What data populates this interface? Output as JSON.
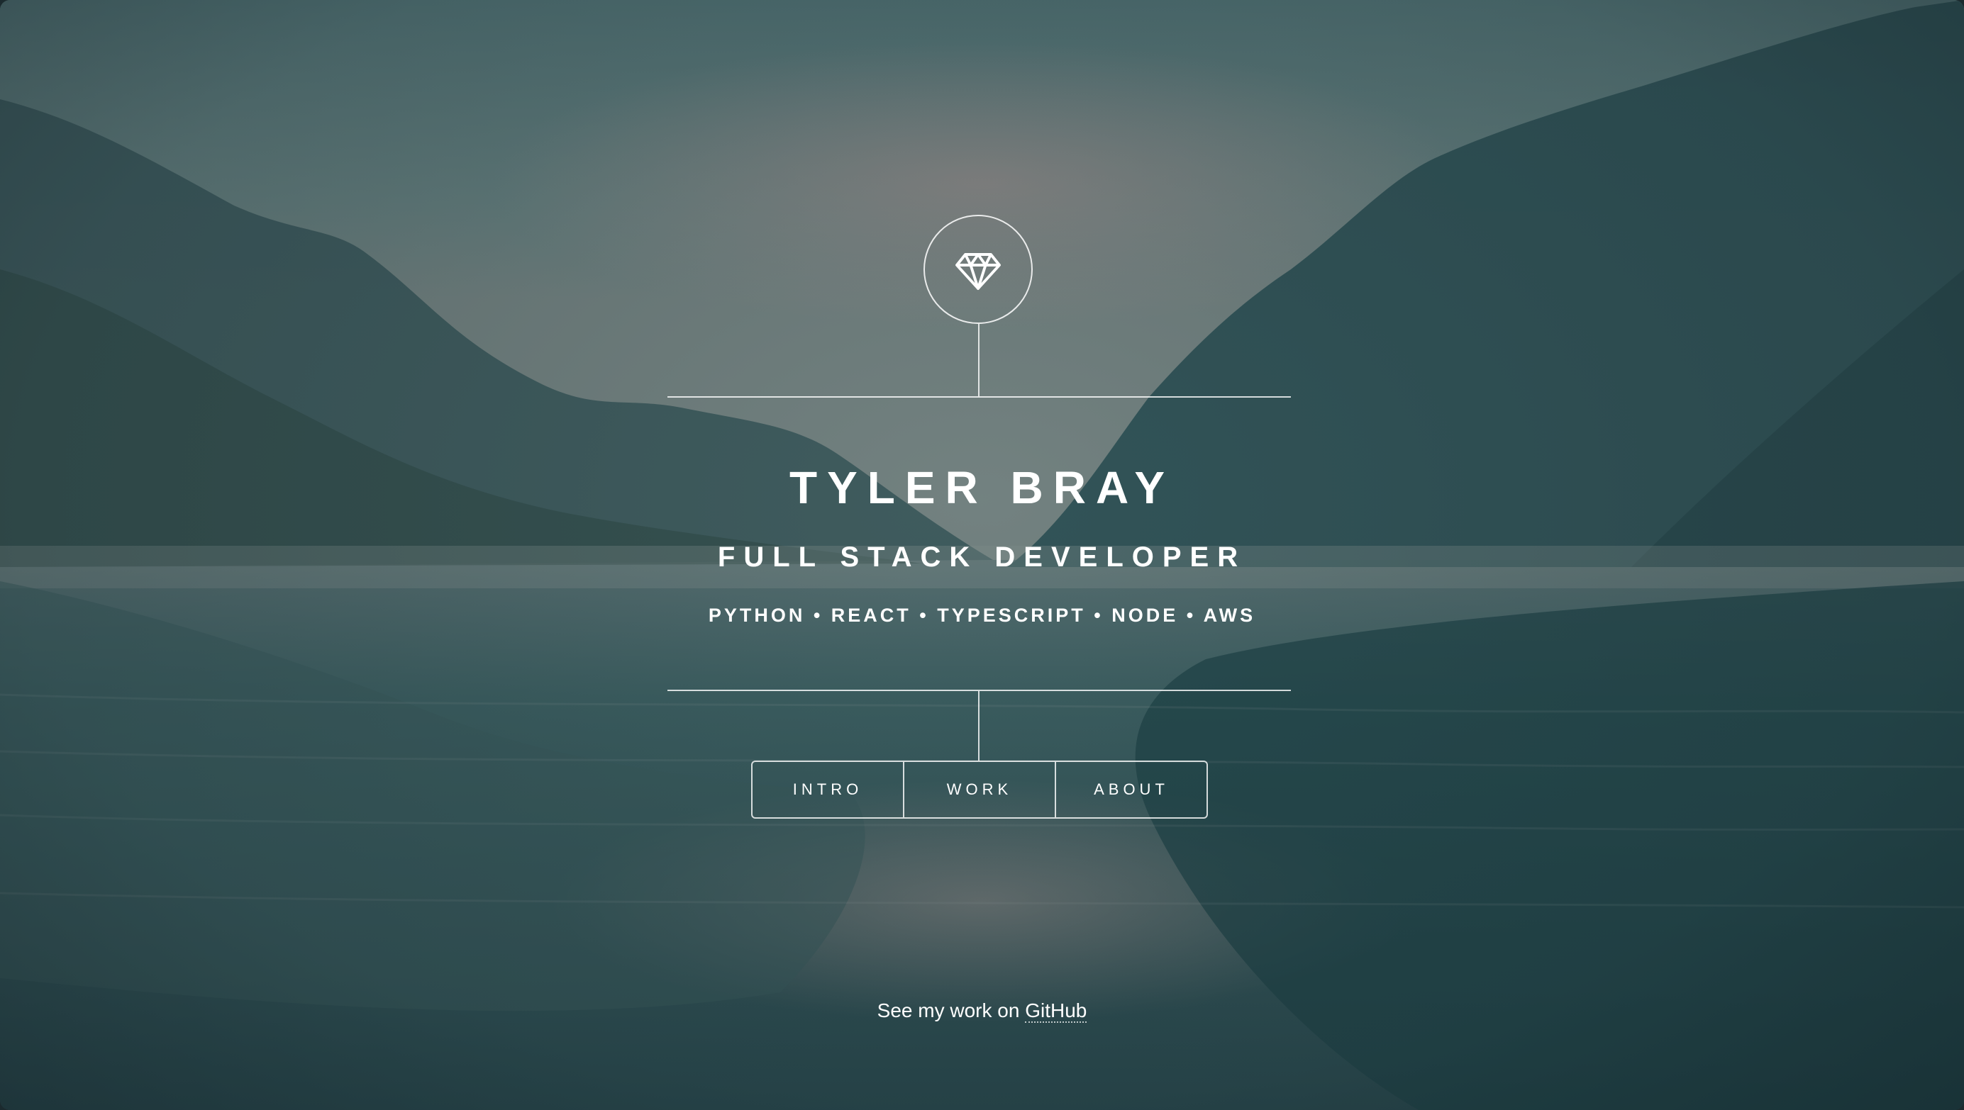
{
  "header": {
    "logo_icon": "diamond-icon"
  },
  "intro": {
    "name": "TYLER BRAY",
    "role": "FULL STACK DEVELOPER",
    "skills": "PYTHON • REACT • TYPESCRIPT • NODE • AWS"
  },
  "nav": {
    "items": [
      {
        "label": "INTRO"
      },
      {
        "label": "WORK"
      },
      {
        "label": "ABOUT"
      }
    ]
  },
  "footer": {
    "prefix": "See my work on ",
    "link_label": "GitHub"
  },
  "colors": {
    "text": "#ffffff",
    "lines": "#ffffffcc",
    "sky": "#5f7f80",
    "water": "#2c5458"
  }
}
